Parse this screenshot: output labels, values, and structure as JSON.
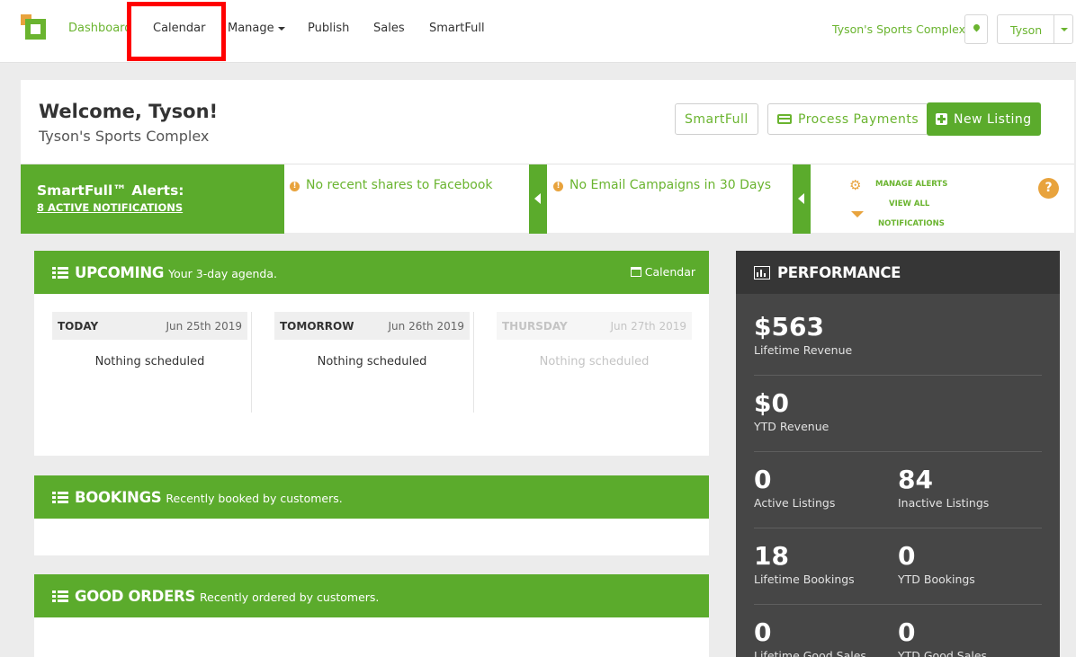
{
  "nav": {
    "items": [
      "Dashboard",
      "Calendar",
      "Manage",
      "Publish",
      "Sales",
      "SmartFull"
    ],
    "venue": "Tyson's Sports Complex",
    "user": "Tyson"
  },
  "welcome": {
    "title": "Welcome, Tyson!",
    "subtitle": "Tyson's Sports Complex",
    "buttons": {
      "smartfull": "SmartFull",
      "process_payments": "Process Payments",
      "new_listing": "New Listing"
    }
  },
  "alerts": {
    "title": "SmartFull™ Alerts:",
    "count_link": "8 ACTIVE NOTIFICATIONS",
    "items": [
      "No recent shares to Facebook",
      "No Email Campaigns in 30 Days"
    ],
    "manage": "MANAGE ALERTS",
    "view_all_1": "VIEW ALL",
    "view_all_2": "NOTIFICATIONS",
    "help": "?"
  },
  "upcoming": {
    "title": "UPCOMING",
    "subtitle": "Your 3-day agenda.",
    "calendar_link": "Calendar",
    "days": [
      {
        "name": "TODAY",
        "date": "Jun 25th 2019",
        "body": "Nothing scheduled"
      },
      {
        "name": "TOMORROW",
        "date": "Jun 26th 2019",
        "body": "Nothing scheduled"
      },
      {
        "name": "THURSDAY",
        "date": "Jun 27th 2019",
        "body": "Nothing scheduled"
      }
    ]
  },
  "bookings": {
    "title": "BOOKINGS",
    "subtitle": "Recently booked by customers."
  },
  "good_orders": {
    "title": "GOOD ORDERS",
    "subtitle": "Recently ordered by customers."
  },
  "performance": {
    "title": "PERFORMANCE",
    "lifetime_revenue": {
      "value": "$563",
      "label": "Lifetime Revenue"
    },
    "ytd_revenue": {
      "value": "$0",
      "label": "YTD Revenue"
    },
    "active_listings": {
      "value": "0",
      "label": "Active Listings"
    },
    "inactive_listings": {
      "value": "84",
      "label": "Inactive Listings"
    },
    "lifetime_bookings": {
      "value": "18",
      "label": "Lifetime Bookings"
    },
    "ytd_bookings": {
      "value": "0",
      "label": "YTD Bookings"
    },
    "lifetime_good_sales": {
      "value": "0",
      "label": "Lifetime Good Sales"
    },
    "ytd_good_sales": {
      "value": "0",
      "label": "YTD Good Sales"
    }
  },
  "colors": {
    "brand_green": "#5bab2c",
    "accent_orange": "#e8a33d",
    "highlight_red": "#ff0000"
  }
}
